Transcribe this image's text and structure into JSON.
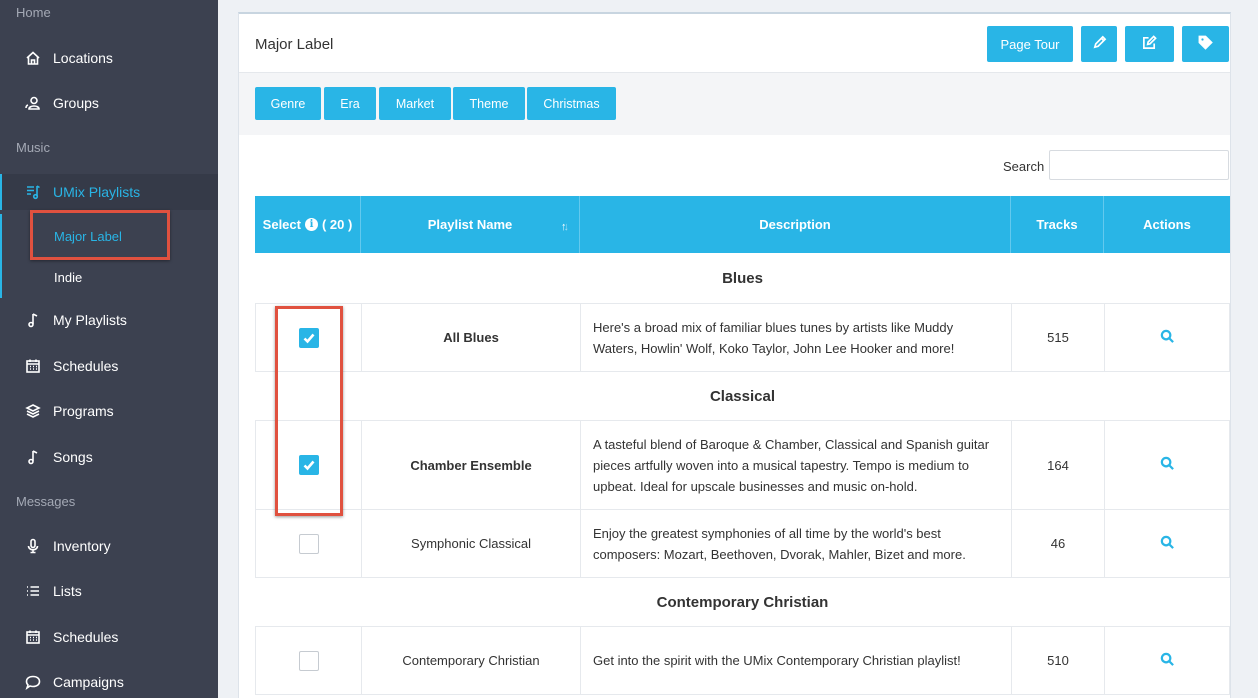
{
  "sidebar": {
    "sections": [
      "Home",
      "Music",
      "Messages"
    ],
    "items": [
      {
        "label": "Locations",
        "icon": "home-icon"
      },
      {
        "label": "Groups",
        "icon": "groups-icon"
      },
      {
        "label": "UMix Playlists",
        "icon": "playlist-icon"
      },
      {
        "label": "My Playlists",
        "icon": "music-note-icon"
      },
      {
        "label": "Schedules",
        "icon": "calendar-icon"
      },
      {
        "label": "Programs",
        "icon": "layers-icon"
      },
      {
        "label": "Songs",
        "icon": "music-note-icon"
      },
      {
        "label": "Inventory",
        "icon": "microphone-icon"
      },
      {
        "label": "Lists",
        "icon": "list-icon"
      },
      {
        "label": "Schedules",
        "icon": "calendar-icon"
      },
      {
        "label": "Campaigns",
        "icon": "chat-icon"
      }
    ],
    "subitems": [
      "Major Label",
      "Indie"
    ]
  },
  "panel": {
    "title": "Major Label",
    "page_tour": "Page Tour",
    "filters": [
      "Genre",
      "Era",
      "Market",
      "Theme",
      "Christmas"
    ],
    "search_label": "Search",
    "search_value": ""
  },
  "table": {
    "headers": {
      "select": "Select",
      "select_count": "( 20 )",
      "name": "Playlist Name",
      "description": "Description",
      "tracks": "Tracks",
      "actions": "Actions"
    },
    "groups": [
      {
        "title": "Blues",
        "rows": [
          {
            "name": "All Blues",
            "description": "Here's a broad mix of familiar blues tunes by artists like Muddy Waters, Howlin' Wolf, Koko Taylor, John Lee Hooker and more!",
            "tracks": "515",
            "checked": true
          }
        ]
      },
      {
        "title": "Classical",
        "rows": [
          {
            "name": "Chamber Ensemble",
            "description": "A tasteful blend of Baroque & Chamber, Classical and Spanish guitar pieces artfully woven into a musical tapestry. Tempo is medium to upbeat. Ideal for upscale businesses and music on-hold.",
            "tracks": "164",
            "checked": true
          },
          {
            "name": "Symphonic Classical",
            "description": "Enjoy the greatest symphonies of all time by the world's best composers: Mozart, Beethoven, Dvorak, Mahler, Bizet and more.",
            "tracks": "46",
            "checked": false
          }
        ]
      },
      {
        "title": "Contemporary Christian",
        "rows": [
          {
            "name": "Contemporary Christian",
            "description": "Get into the spirit with the UMix Contemporary Christian playlist!",
            "tracks": "510",
            "checked": false
          }
        ]
      }
    ]
  },
  "colors": {
    "accent": "#29b5e6",
    "sidebar": "#3c4150",
    "highlight": "#e0513f"
  }
}
